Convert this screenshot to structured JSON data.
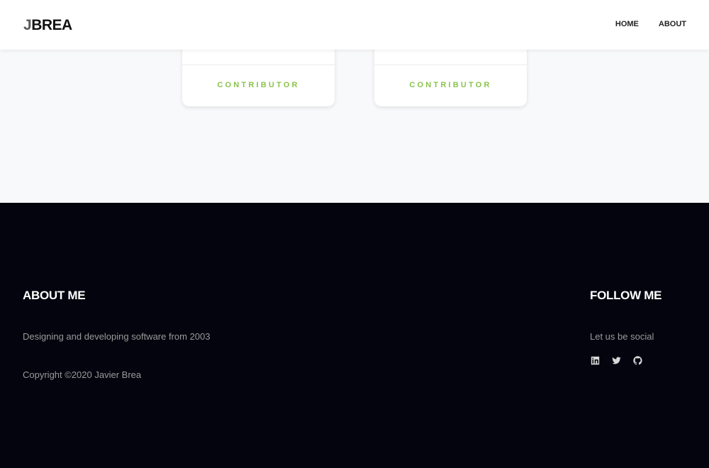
{
  "navbar": {
    "brand_initial": "J",
    "brand_rest": "BREA",
    "links": [
      {
        "label": "HOME"
      },
      {
        "label": "ABOUT"
      }
    ]
  },
  "cards": [
    {
      "role": "CONTRIBUTOR"
    },
    {
      "role": "CONTRIBUTOR"
    }
  ],
  "footer": {
    "about": {
      "title": "ABOUT ME",
      "text": "Designing and developing software from 2003",
      "copyright": "Copyright ©2020 Javier Brea"
    },
    "follow": {
      "title": "FOLLOW ME",
      "text": "Let us be social",
      "icons": [
        "linkedin-icon",
        "twitter-icon",
        "github-icon"
      ]
    }
  },
  "colors": {
    "accent": "#8bc34a",
    "footer_bg": "#04040f",
    "page_bg": "#f8f9fa"
  }
}
